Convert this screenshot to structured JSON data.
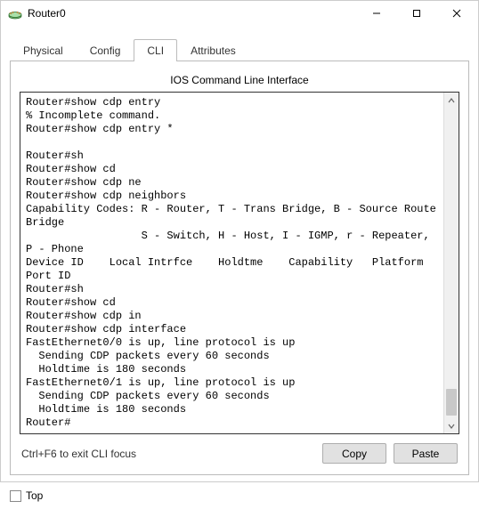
{
  "window": {
    "title": "Router0"
  },
  "tabs": {
    "physical": "Physical",
    "config": "Config",
    "cli": "CLI",
    "attributes": "Attributes"
  },
  "cli": {
    "heading": "IOS Command Line Interface",
    "output": "Router#show cdp entry\n% Incomplete command.\nRouter#show cdp entry *\n\nRouter#sh\nRouter#show cd\nRouter#show cdp ne\nRouter#show cdp neighbors\nCapability Codes: R - Router, T - Trans Bridge, B - Source Route Bridge\n                  S - Switch, H - Host, I - IGMP, r - Repeater, P - Phone\nDevice ID    Local Intrfce    Holdtme    Capability   Platform   Port ID\nRouter#sh\nRouter#show cd\nRouter#show cdp in\nRouter#show cdp interface\nFastEthernet0/0 is up, line protocol is up\n  Sending CDP packets every 60 seconds\n  Holdtime is 180 seconds\nFastEthernet0/1 is up, line protocol is up\n  Sending CDP packets every 60 seconds\n  Holdtime is 180 seconds\nRouter#",
    "hint": "Ctrl+F6 to exit CLI focus",
    "copy": "Copy",
    "paste": "Paste"
  },
  "footer": {
    "top": "Top"
  }
}
